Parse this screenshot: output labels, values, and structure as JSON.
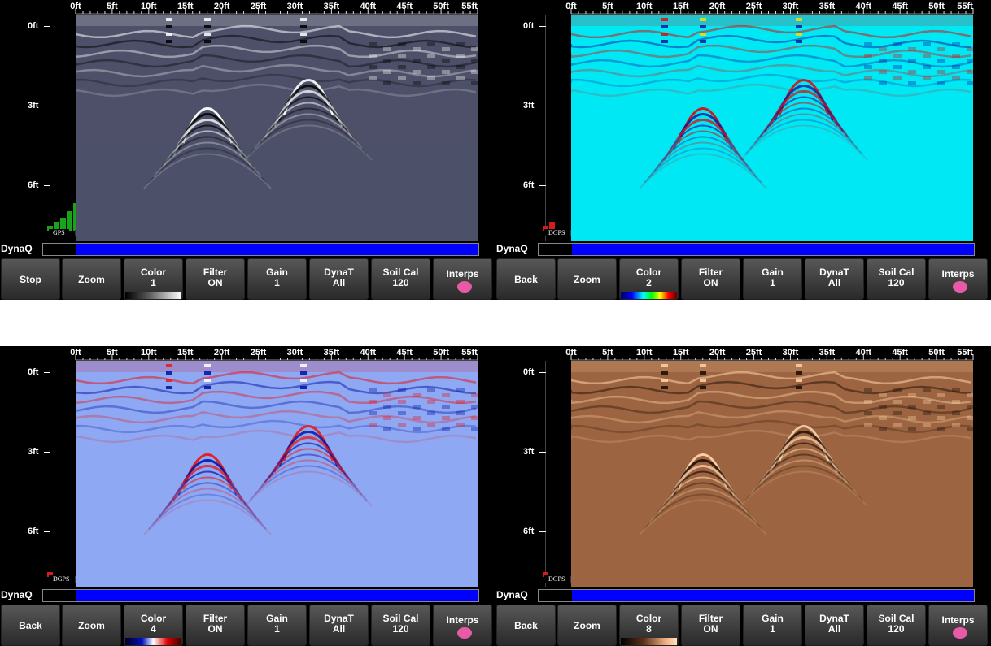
{
  "x_axis": {
    "labels": [
      "0ft",
      "5ft",
      "10ft",
      "15ft",
      "20ft",
      "25ft",
      "30ft",
      "35ft",
      "40ft",
      "45ft",
      "50ft",
      "55ft"
    ]
  },
  "y_axis": {
    "labels": [
      "0ft",
      "3ft",
      "6ft"
    ]
  },
  "dynaq_label": "DynaQ",
  "colors": {
    "dynaq_fill": "#0000ff",
    "gps_green": "#18a418",
    "gps_red": "#d41c1c",
    "interps_dot": "#e85aa6"
  },
  "panels": [
    {
      "first_button": "Stop",
      "gps_text": "GPS",
      "gps_signal_level": 5,
      "gps_signal_color": "green",
      "color_value": "1",
      "palette": "grayscale",
      "bg": "#4d5068"
    },
    {
      "first_button": "Back",
      "gps_text": "DGPS",
      "gps_signal_level": 2,
      "gps_signal_color": "red",
      "color_value": "2",
      "palette": "rainbow",
      "bg": "#00e8f4"
    },
    {
      "first_button": "Back",
      "gps_text": "DGPS",
      "gps_signal_level": 1,
      "gps_signal_color": "red",
      "color_value": "4",
      "palette": "blue-red",
      "bg": "#8ea8f4"
    },
    {
      "first_button": "Back",
      "gps_text": "DGPS",
      "gps_signal_level": 1,
      "gps_signal_color": "red",
      "color_value": "8",
      "palette": "copper",
      "bg": "#9c6440"
    }
  ],
  "buttons": {
    "zoom": "Zoom",
    "color": "Color",
    "filter": "Filter",
    "filter_value": "ON",
    "gain": "Gain",
    "gain_value": "1",
    "dynat": "DynaT",
    "dynat_value": "All",
    "soilcal": "Soil Cal",
    "soilcal_value": "120",
    "interps": "Interps"
  }
}
